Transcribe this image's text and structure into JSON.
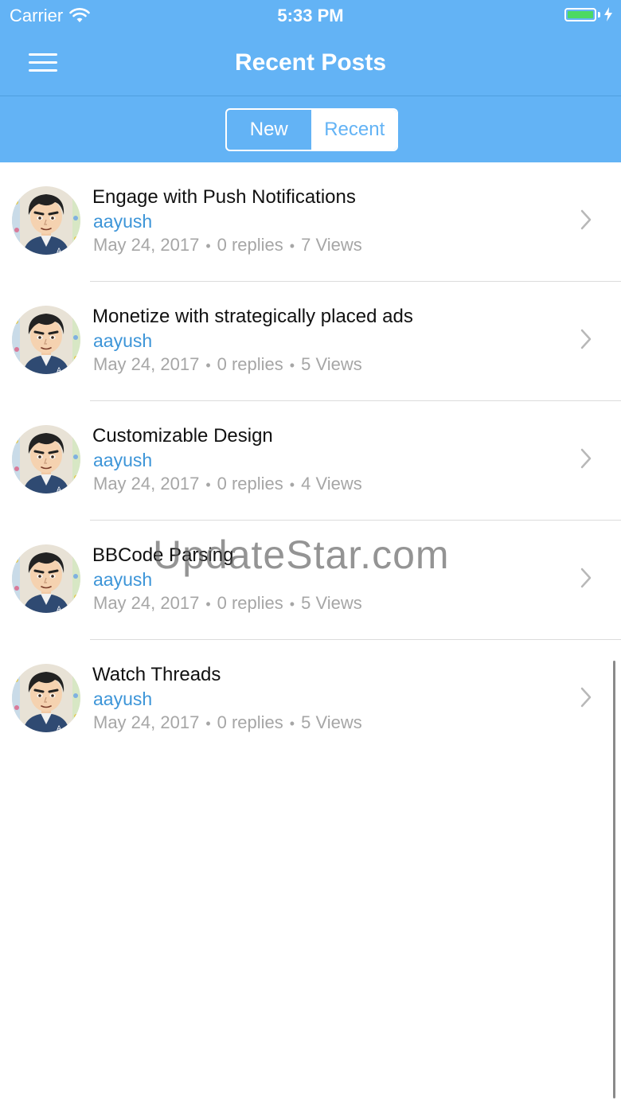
{
  "status_bar": {
    "carrier": "Carrier",
    "time": "5:33 PM",
    "battery_color": "#4cd964"
  },
  "nav": {
    "title": "Recent Posts",
    "menu_icon": "hamburger-icon"
  },
  "segment": {
    "options": [
      "New",
      "Recent"
    ],
    "selected": "Recent"
  },
  "posts": [
    {
      "title": "Engage with Push Notifications",
      "author": "aayush",
      "date": "May 24, 2017",
      "replies": "0 replies",
      "views": "7 Views"
    },
    {
      "title": "Monetize with strategically placed ads",
      "author": "aayush",
      "date": "May 24, 2017",
      "replies": "0 replies",
      "views": "5 Views"
    },
    {
      "title": "Customizable Design",
      "author": "aayush",
      "date": "May 24, 2017",
      "replies": "0 replies",
      "views": "4 Views"
    },
    {
      "title": "BBCode Parsing",
      "author": "aayush",
      "date": "May 24, 2017",
      "replies": "0 replies",
      "views": "5 Views"
    },
    {
      "title": "Watch Threads",
      "author": "aayush",
      "date": "May 24, 2017",
      "replies": "0 replies",
      "views": "5 Views"
    }
  ],
  "meta_separator": "•",
  "watermark": "UpdateStar.com",
  "colors": {
    "header": "#63b3f5",
    "author": "#3d95d8",
    "meta": "#a6a6a6"
  }
}
